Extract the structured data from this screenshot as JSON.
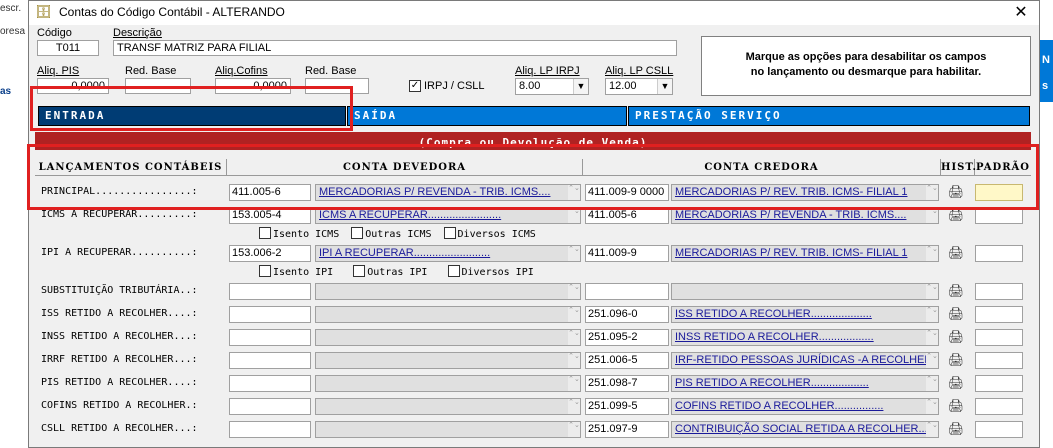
{
  "background": {
    "left_texts": [
      "escr.",
      "oresa",
      "as"
    ],
    "right_texts": [
      "N",
      "s"
    ]
  },
  "window": {
    "title": "Contas do Código Contábil  -  ALTERANDO",
    "close_label": "✕"
  },
  "form": {
    "codigo_label": "Código",
    "codigo_value": "T011",
    "descricao_label": "Descrição",
    "descricao_value": "TRANSF MATRIZ PARA FILIAL",
    "aliq_pis_label": "Aliq. PIS",
    "aliq_pis_value": "0,0000",
    "red_base1_label": "Red. Base",
    "red_base1_value": "",
    "aliq_cofins_label": "Aliq.Cofins",
    "aliq_cofins_value": "0,0000",
    "red_base2_label": "Red. Base",
    "red_base2_value": "",
    "irpj_label": "IRPJ / CSLL",
    "irpj_checked": "✓",
    "lp_irpj_label": "Aliq. LP IRPJ",
    "lp_irpj_value": "8.00",
    "lp_csll_label": "Aliq. LP CSLL",
    "lp_csll_value": "12.00",
    "info": "Marque as opções para desabilitar os campos\nno lançamento ou desmarque para habilitar."
  },
  "tabs": [
    {
      "label": "ENTRADA",
      "active": true
    },
    {
      "label": "SAÍDA",
      "active": false
    },
    {
      "label": "PRESTAÇÃO SERVIÇO",
      "active": false
    }
  ],
  "band_text": "(Compra ou Devolução de Venda)",
  "headers": {
    "lancamentos": "LANÇAMENTOS CONTÁBEIS",
    "devedora": "CONTA DEVEDORA",
    "credora": "CONTA CREDORA",
    "hist": "HIST.",
    "padrao": "PADRÃO"
  },
  "rows": [
    {
      "label": "PRINCIPAL................:",
      "deb_code": "411.005-6",
      "deb_desc": "MERCADORIAS P/ REVENDA - TRIB. ICMS....",
      "cred_code": "411.009-9 0000",
      "cred_desc": "MERCADORIAS P/ REV. TRIB. ICMS- FILIAL 1"
    },
    {
      "label": "ICMS A RECUPERAR.........:",
      "deb_code": "153.005-4",
      "deb_desc": "ICMS A RECUPERAR........................",
      "cred_code": "411.005-6",
      "cred_desc": "MERCADORIAS P/ REVENDA - TRIB. ICMS...."
    },
    {
      "label": "IPI A RECUPERAR..........:",
      "deb_code": "153.006-2",
      "deb_desc": "IPI A RECUPERAR.........................",
      "cred_code": "411.009-9",
      "cred_desc": "MERCADORIAS P/ REV. TRIB. ICMS- FILIAL 1"
    },
    {
      "label": "SUBSTITUIÇÃO TRIBUTÁRIA..:",
      "deb_code": "",
      "deb_desc": "",
      "cred_code": "",
      "cred_desc": ""
    },
    {
      "label": "ISS RETIDO A RECOLHER....:",
      "deb_code": "",
      "deb_desc": "",
      "cred_code": "251.096-0",
      "cred_desc": "ISS RETIDO A RECOLHER...................."
    },
    {
      "label": "INSS RETIDO A RECOLHER...:",
      "deb_code": "",
      "deb_desc": "",
      "cred_code": "251.095-2",
      "cred_desc": "INSS RETIDO A RECOLHER.................."
    },
    {
      "label": "IRRF RETIDO A RECOLHER...:",
      "deb_code": "",
      "deb_desc": "",
      "cred_code": "251.006-5",
      "cred_desc": "IRF-RETIDO PESSOAS JURÍDICAS -A RECOLHER"
    },
    {
      "label": "PIS RETIDO A RECOLHER....:",
      "deb_code": "",
      "deb_desc": "",
      "cred_code": "251.098-7",
      "cred_desc": "PIS RETIDO A RECOLHER..................."
    },
    {
      "label": "COFINS RETIDO A RECOLHER.:",
      "deb_code": "",
      "deb_desc": "",
      "cred_code": "251.099-5",
      "cred_desc": "COFINS RETIDO A RECOLHER................"
    },
    {
      "label": "CSLL RETIDO A RECOLHER...:",
      "deb_code": "",
      "deb_desc": "",
      "cred_code": "251.097-9",
      "cred_desc": "CONTRIBUIÇÃO SOCIAL RETIDA A RECOLHER..."
    }
  ],
  "icms_checks": [
    "Isento ICMS",
    "Outras ICMS",
    "Diversos ICMS"
  ],
  "ipi_checks": [
    "Isento IPI",
    "Outras IPI",
    "Diversos IPI"
  ],
  "colors": {
    "tab_active": "#003c74",
    "tab_inactive": "#0078d7",
    "band": "#b02222",
    "highlight": "#e02020"
  }
}
